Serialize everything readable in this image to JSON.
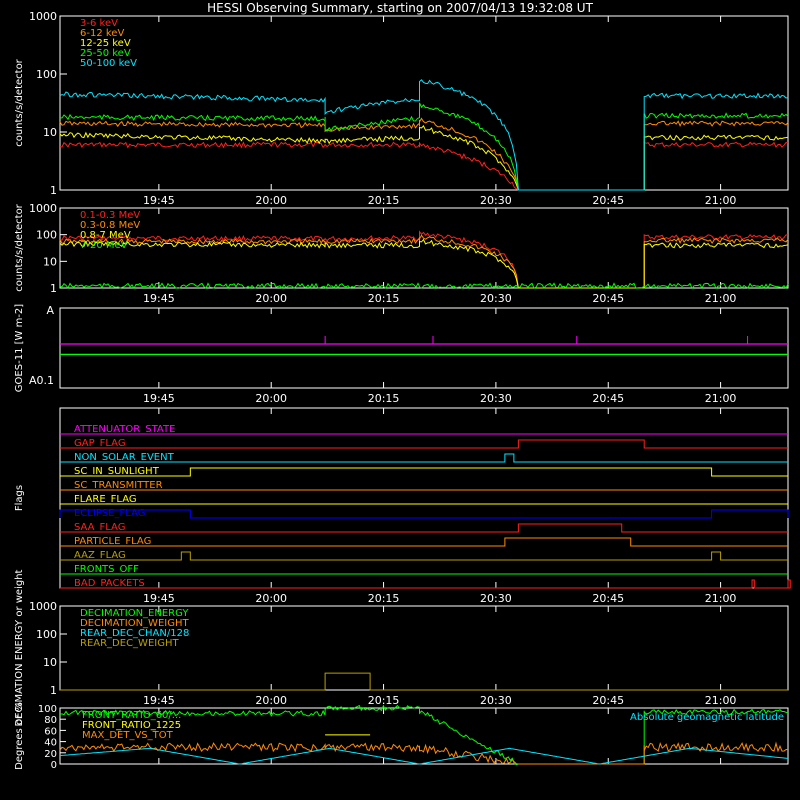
{
  "title": "HESSI Observing Summary, starting on 2007/04/13 19:32:08 UT",
  "colors": {
    "background": "#000000",
    "axes": "#ffffff",
    "red": "#ff2020",
    "orange": "#ff8c00",
    "yellow": "#ffff00",
    "green": "#00ff00",
    "cyan": "#00e5ff",
    "magenta": "#ff00ff",
    "blue": "#0000ff",
    "olive": "#b8a000",
    "lightorange": "#ffa040"
  },
  "chart_data": [
    {
      "id": "lightcurves",
      "type": "line",
      "ylabel": "counts/s/detector",
      "yscale": "log",
      "ylim": [
        1,
        1000
      ],
      "yticks": [
        "1",
        "10",
        "100",
        "1000"
      ],
      "xticks": [
        "19:45",
        "20:00",
        "20:15",
        "20:30",
        "20:45",
        "21:00"
      ],
      "legend_placement": "top-left",
      "series": [
        {
          "name": "3-6 keV",
          "color": "red",
          "x": [
            19.53,
            20.12,
            20.12,
            20.33,
            20.33,
            20.55,
            20.55,
            20.83,
            20.83,
            21.15
          ],
          "values": [
            6,
            6,
            6,
            6,
            6,
            1,
            1,
            1,
            6,
            6
          ]
        },
        {
          "name": "6-12 keV",
          "color": "orange",
          "x": [
            19.53,
            20.12,
            20.12,
            20.33,
            20.33,
            20.55,
            20.55,
            20.83,
            20.83,
            21.15
          ],
          "values": [
            14,
            13,
            11,
            13,
            16,
            1,
            1,
            1,
            14,
            14
          ]
        },
        {
          "name": "12-25 keV",
          "color": "yellow",
          "x": [
            19.53,
            20.12,
            20.12,
            20.33,
            20.33,
            20.55,
            20.55,
            20.83,
            20.83,
            21.15
          ],
          "values": [
            9,
            7,
            7,
            8,
            12,
            1,
            1,
            1,
            8,
            8
          ]
        },
        {
          "name": "25-50 keV",
          "color": "green",
          "x": [
            19.53,
            20.12,
            20.12,
            20.33,
            20.33,
            20.55,
            20.55,
            20.83,
            20.83,
            21.15
          ],
          "values": [
            18,
            17,
            11,
            17,
            30,
            1,
            1,
            1,
            19,
            19
          ]
        },
        {
          "name": "50-100 keV",
          "color": "cyan",
          "x": [
            19.53,
            20.12,
            20.12,
            20.33,
            20.33,
            20.55,
            20.55,
            20.83,
            20.83,
            21.15
          ],
          "values": [
            45,
            35,
            22,
            38,
            80,
            1,
            1,
            1,
            42,
            42
          ]
        }
      ]
    },
    {
      "id": "gamma",
      "type": "line",
      "ylabel": "counts/s/detector",
      "yscale": "log",
      "ylim": [
        1,
        1000
      ],
      "yticks": [
        "1",
        "10",
        "100",
        "1000"
      ],
      "xticks": [
        "19:45",
        "20:00",
        "20:15",
        "20:30",
        "20:45",
        "21:00"
      ],
      "legend_placement": "top-left",
      "series": [
        {
          "name": "0.1-0.3 MeV",
          "color": "red",
          "x": [
            19.53,
            20.12,
            20.12,
            20.33,
            20.33,
            20.55,
            20.55,
            20.83,
            20.83,
            21.15
          ],
          "values": [
            75,
            70,
            70,
            75,
            110,
            1,
            1,
            1,
            80,
            80
          ]
        },
        {
          "name": "0.3-0.8 MeV",
          "color": "orange",
          "x": [
            19.53,
            20.12,
            20.12,
            20.33,
            20.33,
            20.55,
            20.55,
            20.83,
            20.83,
            21.15
          ],
          "values": [
            55,
            55,
            55,
            60,
            80,
            1,
            1,
            1,
            60,
            60
          ]
        },
        {
          "name": "0.8-7 MeV",
          "color": "yellow",
          "x": [
            19.53,
            20.12,
            20.12,
            20.33,
            20.33,
            20.55,
            20.55,
            20.83,
            20.83,
            21.15
          ],
          "values": [
            45,
            40,
            40,
            40,
            55,
            1,
            1,
            1,
            40,
            40
          ]
        },
        {
          "name": "7-20 MeV",
          "color": "green",
          "x": [
            19.53,
            21.15
          ],
          "values": [
            1.2,
            1.2
          ]
        }
      ]
    },
    {
      "id": "goes",
      "type": "line",
      "ylabel": "GOES-11 [W m-2]",
      "yticks": [
        "A",
        "A0.1"
      ],
      "xticks": [
        "19:45",
        "20:00",
        "20:15",
        "20:30",
        "20:45",
        "21:00"
      ],
      "series": [
        {
          "name": "GOES long",
          "color": "green",
          "level": 0.42
        },
        {
          "name": "GOES short",
          "color": "magenta",
          "level": 0.55
        }
      ]
    },
    {
      "id": "flags",
      "type": "line",
      "ylabel": "Flags",
      "xticks": [
        "19:45",
        "20:00",
        "20:15",
        "20:30",
        "20:45",
        "21:00"
      ],
      "flags": [
        {
          "name": "ATTENUATOR_STATE",
          "color": "magenta",
          "on": []
        },
        {
          "name": "GAP_FLAG",
          "color": "red",
          "on": [
            [
              20.55,
              20.83
            ]
          ]
        },
        {
          "name": "NON_SOLAR_EVENT",
          "color": "cyan",
          "on": [
            [
              20.52,
              20.54
            ]
          ]
        },
        {
          "name": "SC_IN_SUNLIGHT",
          "color": "yellow",
          "on": [
            [
              19.82,
              20.98
            ]
          ]
        },
        {
          "name": "SC_TRANSMITTER",
          "color": "orange",
          "on": []
        },
        {
          "name": "FLARE_FLAG",
          "color": "yellow",
          "on": []
        },
        {
          "name": "ECLIPSE_FLAG",
          "color": "blue",
          "on": [
            [
              19.53,
              19.82
            ],
            [
              20.98,
              21.15
            ]
          ]
        },
        {
          "name": "SAA_FLAG",
          "color": "red",
          "on": [
            [
              20.55,
              20.78
            ]
          ]
        },
        {
          "name": "PARTICLE_FLAG",
          "color": "orange",
          "on": [
            [
              20.52,
              20.8
            ]
          ]
        },
        {
          "name": "AAZ_FLAG",
          "color": "olive",
          "on": [
            [
              19.8,
              19.82
            ],
            [
              20.98,
              21.0
            ]
          ]
        },
        {
          "name": "FRONTS_OFF",
          "color": "green",
          "on": []
        },
        {
          "name": "BAD_PACKETS",
          "color": "red",
          "on": [
            [
              21.07,
              21.075
            ],
            [
              21.15,
              21.155
            ]
          ]
        }
      ]
    },
    {
      "id": "decimation",
      "type": "line",
      "ylabel": "DECIMATION ENERGY or weight",
      "yscale": "log",
      "ylim": [
        1,
        1000
      ],
      "yticks": [
        "1",
        "10",
        "100",
        "1000"
      ],
      "xticks": [
        "19:45",
        "20:00",
        "20:15",
        "20:30",
        "20:45",
        "21:00"
      ],
      "legend_placement": "top-left",
      "series": [
        {
          "name": "DECIMATION_ENERGY",
          "color": "green",
          "x": [],
          "values": []
        },
        {
          "name": "DECIMATION_WEIGHT",
          "color": "orange",
          "x": [],
          "values": []
        },
        {
          "name": "REAR_DEC_CHAN/128",
          "color": "cyan",
          "x": [],
          "values": []
        },
        {
          "name": "REAR_DEC_WEIGHT",
          "color": "olive",
          "x": [
            19.53,
            20.12,
            20.12,
            20.22,
            20.22,
            21.15
          ],
          "values": [
            1,
            1,
            4,
            4,
            1,
            1
          ]
        }
      ]
    },
    {
      "id": "ratios",
      "type": "line",
      "ylabel": "Degrees or %",
      "ylim": [
        0,
        100
      ],
      "yticks": [
        "0",
        "20",
        "40",
        "60",
        "80",
        "100"
      ],
      "xticks": [],
      "legend_placement": "top-left",
      "annotation": "Absolute geomagnetic latitude",
      "series": [
        {
          "name": "FRONT_RATIO_60/...",
          "color": "green",
          "x": [
            19.53,
            20.12,
            20.12,
            20.33,
            20.33,
            20.55,
            20.55,
            20.83,
            20.83,
            21.15
          ],
          "values": [
            92,
            90,
            100,
            100,
            95,
            0,
            0,
            0,
            93,
            93
          ]
        },
        {
          "name": "FRONT_RATIO_1225",
          "color": "yellow",
          "x": [
            20.12,
            20.22
          ],
          "values": [
            52,
            52
          ]
        },
        {
          "name": "MAX_DET_VS_TOT",
          "color": "orange",
          "x": [
            19.53,
            20.12,
            20.12,
            20.33,
            20.33,
            20.55,
            20.55,
            20.83,
            20.83,
            21.15
          ],
          "values": [
            30,
            30,
            30,
            30,
            30,
            0,
            0,
            0,
            30,
            30
          ]
        },
        {
          "name": "Absolute geomagnetic latitude",
          "color": "cyan",
          "x": [
            19.53,
            19.73,
            19.93,
            20.13,
            20.33,
            20.53,
            20.73,
            20.93,
            21.15
          ],
          "values": [
            15,
            28,
            0,
            28,
            0,
            28,
            0,
            28,
            10
          ]
        }
      ]
    }
  ]
}
